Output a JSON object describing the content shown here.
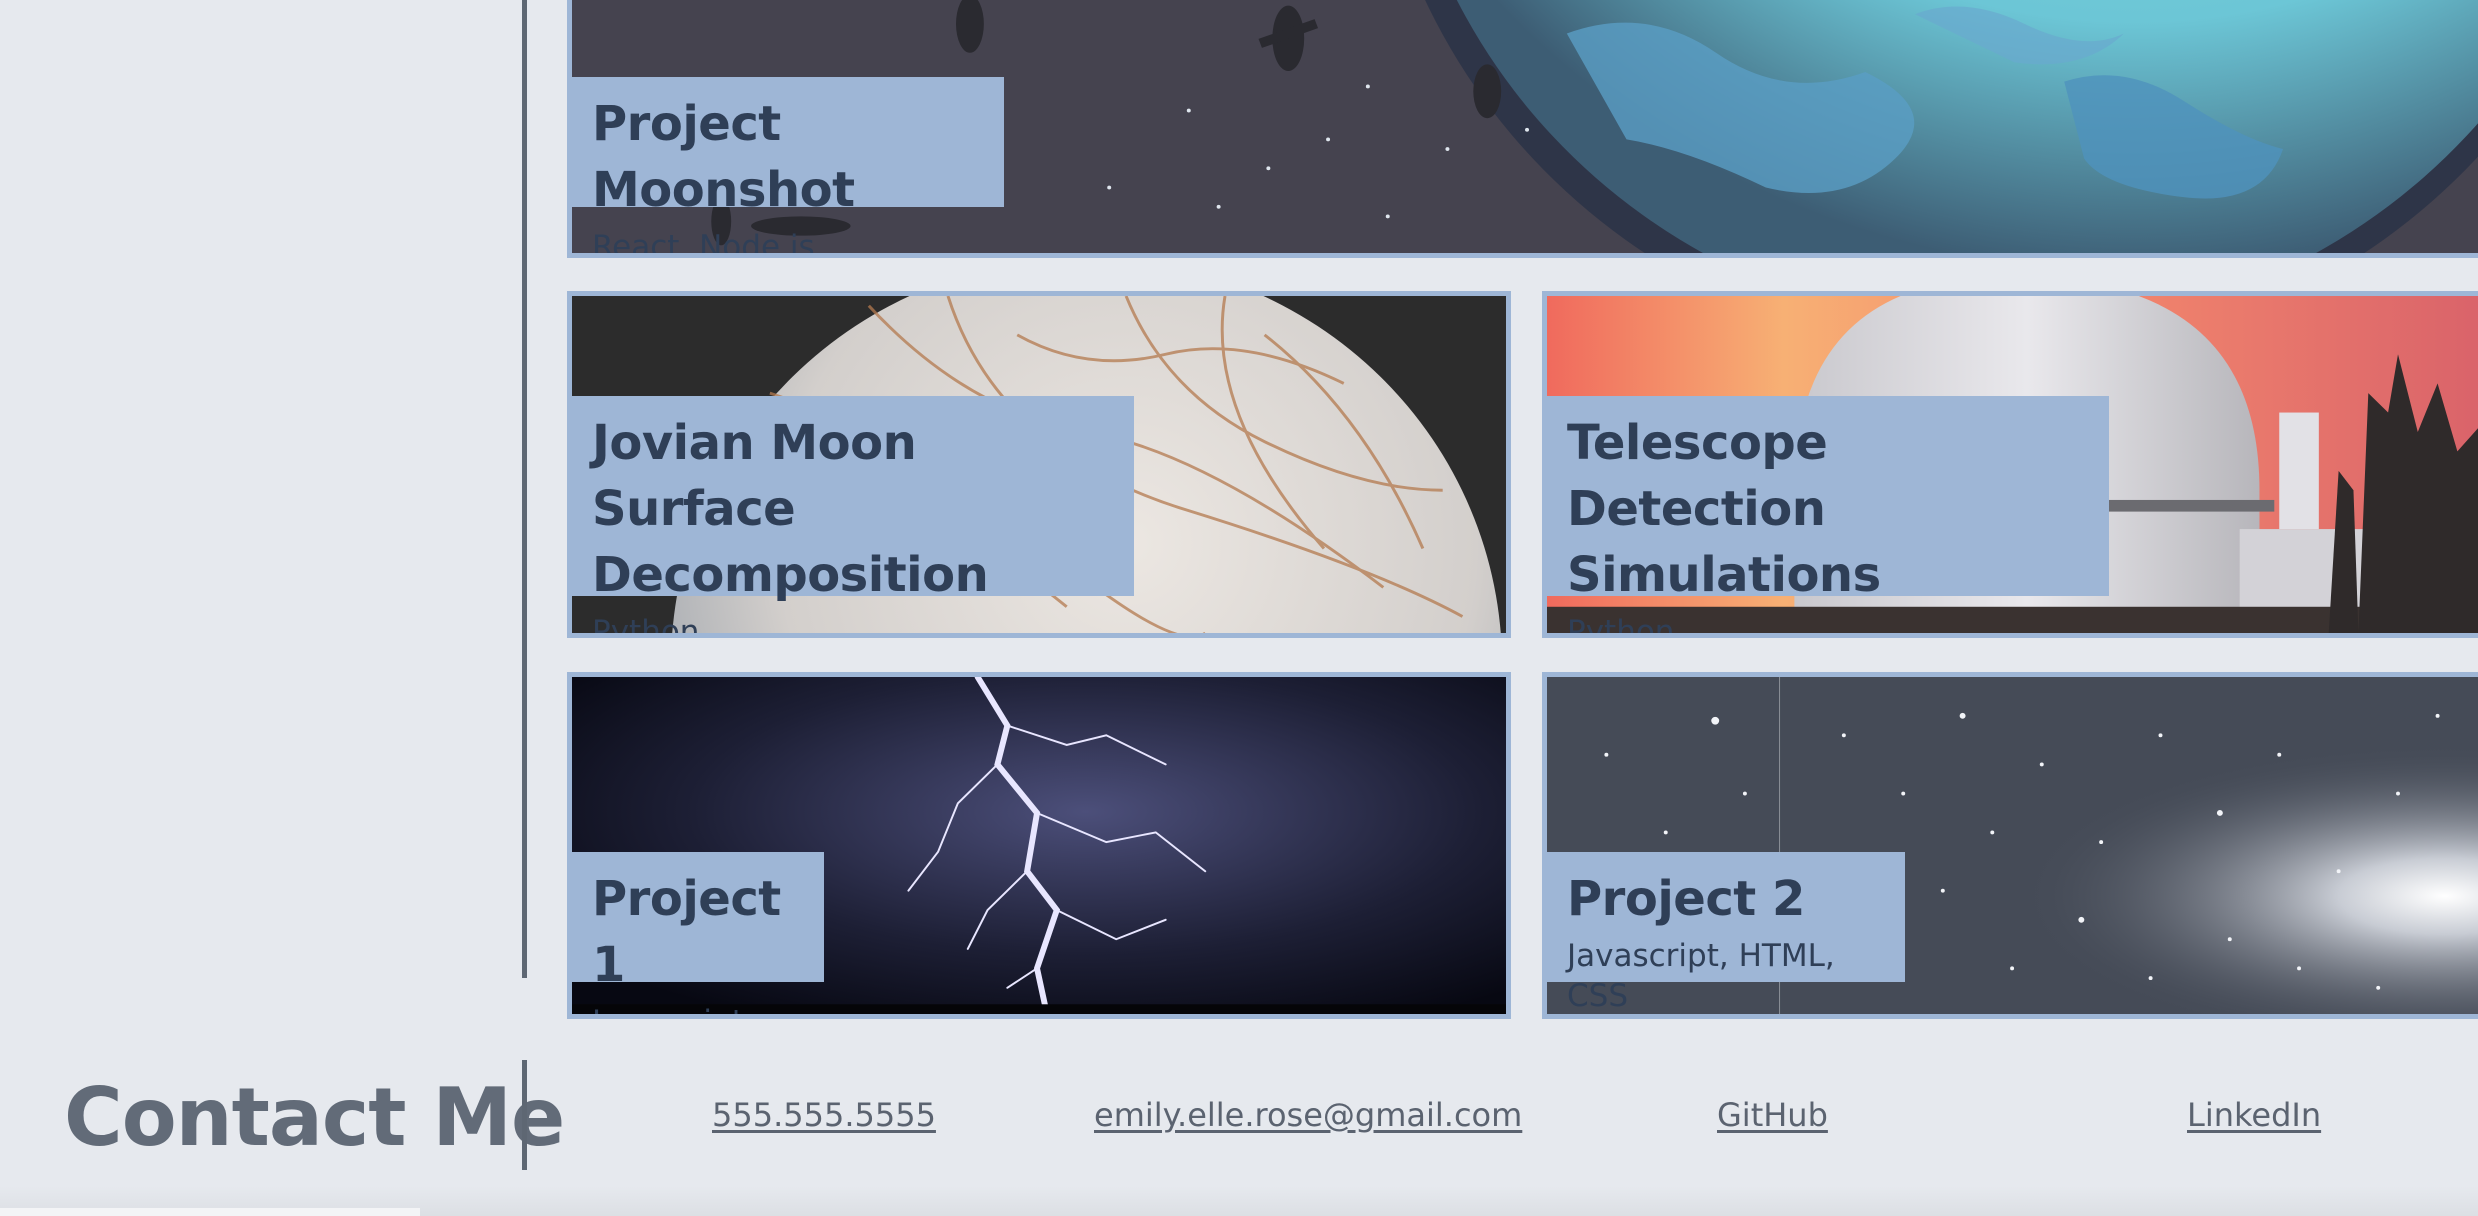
{
  "projects": [
    {
      "title": "Project Moonshot",
      "tech": "React, Node.js",
      "image": "astronauts-moon-image"
    },
    {
      "title": "Jovian Moon Surface Decomposition",
      "title_line1": "Jovian Moon Surface",
      "title_line2": "Decomposition",
      "tech": "Python",
      "image": "europa-moon-image"
    },
    {
      "title": "Telescope Detection Simulations",
      "title_line1": "Telescope Detection",
      "title_line2": "Simulations",
      "tech": "Python",
      "image": "observatory-dome-image"
    },
    {
      "title": "Project 1",
      "tech": "Javascript",
      "image": "lightning-image"
    },
    {
      "title": "Project 2",
      "tech": "Javascript, HTML, CSS",
      "image": "star-field-image"
    }
  ],
  "contact": {
    "title": "Contact Me",
    "phone": "555.555.5555",
    "email": "emily.elle.rose@gmail.com",
    "github": "GitHub",
    "linkedin": "LinkedIn"
  },
  "colors": {
    "background": "#e6e9ee",
    "label_bg": "#9eb6d6",
    "label_text": "#2f3f57",
    "rule": "#5e6773"
  }
}
